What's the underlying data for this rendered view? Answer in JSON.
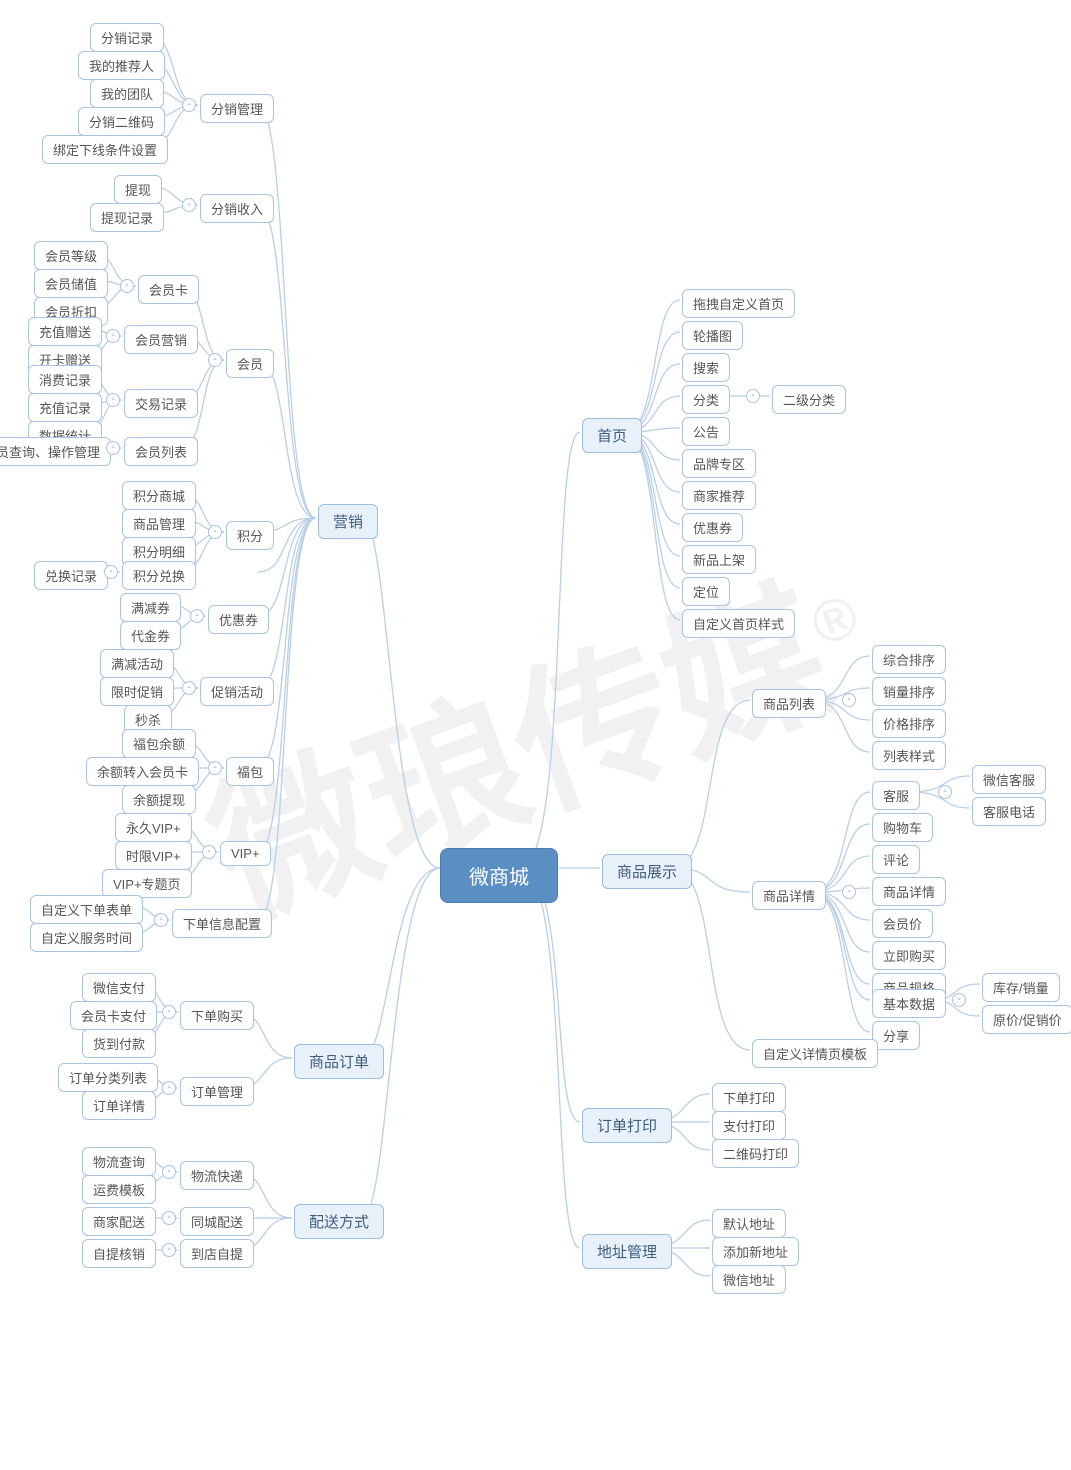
{
  "root": "微商城",
  "watermark": "微琅传媒",
  "collapse": "-",
  "cat": {
    "home": "首页",
    "product": "商品展示",
    "print": "订单打印",
    "addr": "地址管理",
    "marketing": "营销",
    "order": "商品订单",
    "ship": "配送方式"
  },
  "home": {
    "drag": "拖拽自定义首页",
    "carousel": "轮播图",
    "search": "搜索",
    "category": "分类",
    "subcat": "二级分类",
    "notice": "公告",
    "brand": "品牌专区",
    "rec": "商家推荐",
    "coupon": "优惠券",
    "new": "新品上架",
    "loc": "定位",
    "style": "自定义首页样式"
  },
  "product": {
    "list": "商品列表",
    "l_sort1": "综合排序",
    "l_sort2": "销量排序",
    "l_sort3": "价格排序",
    "l_style": "列表样式",
    "detail": "商品详情",
    "d_cs": "客服",
    "d_cs_wx": "微信客服",
    "d_cs_tel": "客服电话",
    "d_cart": "购物车",
    "d_comment": "评论",
    "d_pd": "商品详情",
    "d_vip": "会员价",
    "d_buy": "立即购买",
    "d_spec": "商品规格",
    "d_base": "基本数据",
    "d_base_stock": "库存/销量",
    "d_base_price": "原价/促销价",
    "d_share": "分享",
    "tpl": "自定义详情页模板"
  },
  "print": {
    "p1": "下单打印",
    "p2": "支付打印",
    "p3": "二维码打印"
  },
  "addr": {
    "a1": "默认地址",
    "a2": "添加新地址",
    "a3": "微信地址"
  },
  "marketing": {
    "dist_mgmt": "分销管理",
    "dm1": "分销记录",
    "dm2": "我的推荐人",
    "dm3": "我的团队",
    "dm4": "分销二维码",
    "dm5": "绑定下线条件设置",
    "dist_inc": "分销收入",
    "di1": "提现",
    "di2": "提现记录",
    "member": "会员",
    "m_card": "会员卡",
    "mc1": "会员等级",
    "mc2": "会员储值",
    "mc3": "会员折扣",
    "m_mkt": "会员营销",
    "mm1": "充值赠送",
    "mm2": "开卡赠送",
    "m_tx": "交易记录",
    "mt1": "消费记录",
    "mt2": "充值记录",
    "mt3": "数据统计",
    "m_list": "会员列表",
    "ml1": "会员查询、操作管理",
    "points": "积分",
    "pt1": "积分商城",
    "pt2": "商品管理",
    "pt3": "积分明细",
    "pt_ex": "积分兑换",
    "pte1": "兑换记录",
    "coupon": "优惠券",
    "c1": "满减券",
    "c2": "代金券",
    "promo": "促销活动",
    "pr1": "满减活动",
    "pr2": "限时促销",
    "pr3": "秒杀",
    "wallet": "福包",
    "w1": "福包余额",
    "w2": "余额转入会员卡",
    "w3": "余额提现",
    "vip": "VIP+",
    "v1": "永久VIP+",
    "v2": "时限VIP+",
    "v3": "VIP+专题页",
    "cfg": "下单信息配置",
    "cf1": "自定义下单表单",
    "cf2": "自定义服务时间"
  },
  "order": {
    "buy": "下单购买",
    "b1": "微信支付",
    "b2": "会员卡支付",
    "b3": "货到付款",
    "mgmt": "订单管理",
    "om1": "订单分类列表",
    "om2": "订单详情"
  },
  "ship": {
    "exp": "物流快递",
    "e1": "物流查询",
    "e2": "运费模板",
    "city": "同城配送",
    "c1": "商家配送",
    "self": "到店自提",
    "s1": "自提核销"
  }
}
